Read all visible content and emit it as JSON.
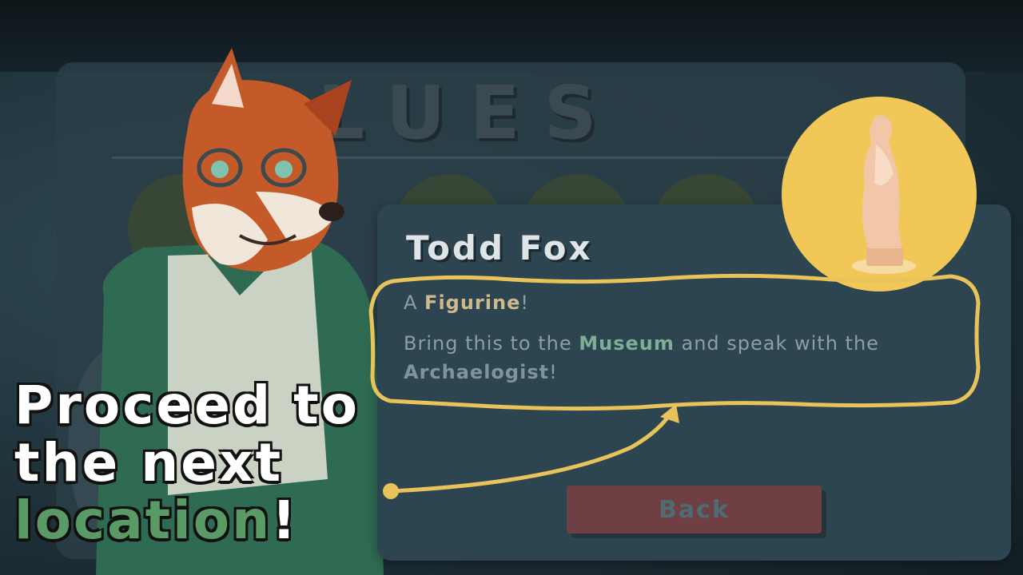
{
  "background": {
    "panel_title": "CLUES"
  },
  "dialog": {
    "speaker": "Todd Fox",
    "line1": {
      "before": "A ",
      "highlight": "Figurine",
      "after": "!"
    },
    "line2": {
      "before": "Bring this to the ",
      "highlight1": "Museum",
      "middle": " and speak with the ",
      "highlight2": "Archaelogist",
      "after": "!"
    },
    "back_label": "Back",
    "item_icon": "figurine-icon"
  },
  "caption": {
    "line1": "Proceed to",
    "line2": "the next",
    "highlight": "location",
    "end": "!"
  },
  "colors": {
    "dialog_bg": "#2c4550",
    "item_circle": "#f1c857",
    "callout": "#e7c35a",
    "back_button": "#6e3f43",
    "highlight_green": "#5a9a64"
  }
}
